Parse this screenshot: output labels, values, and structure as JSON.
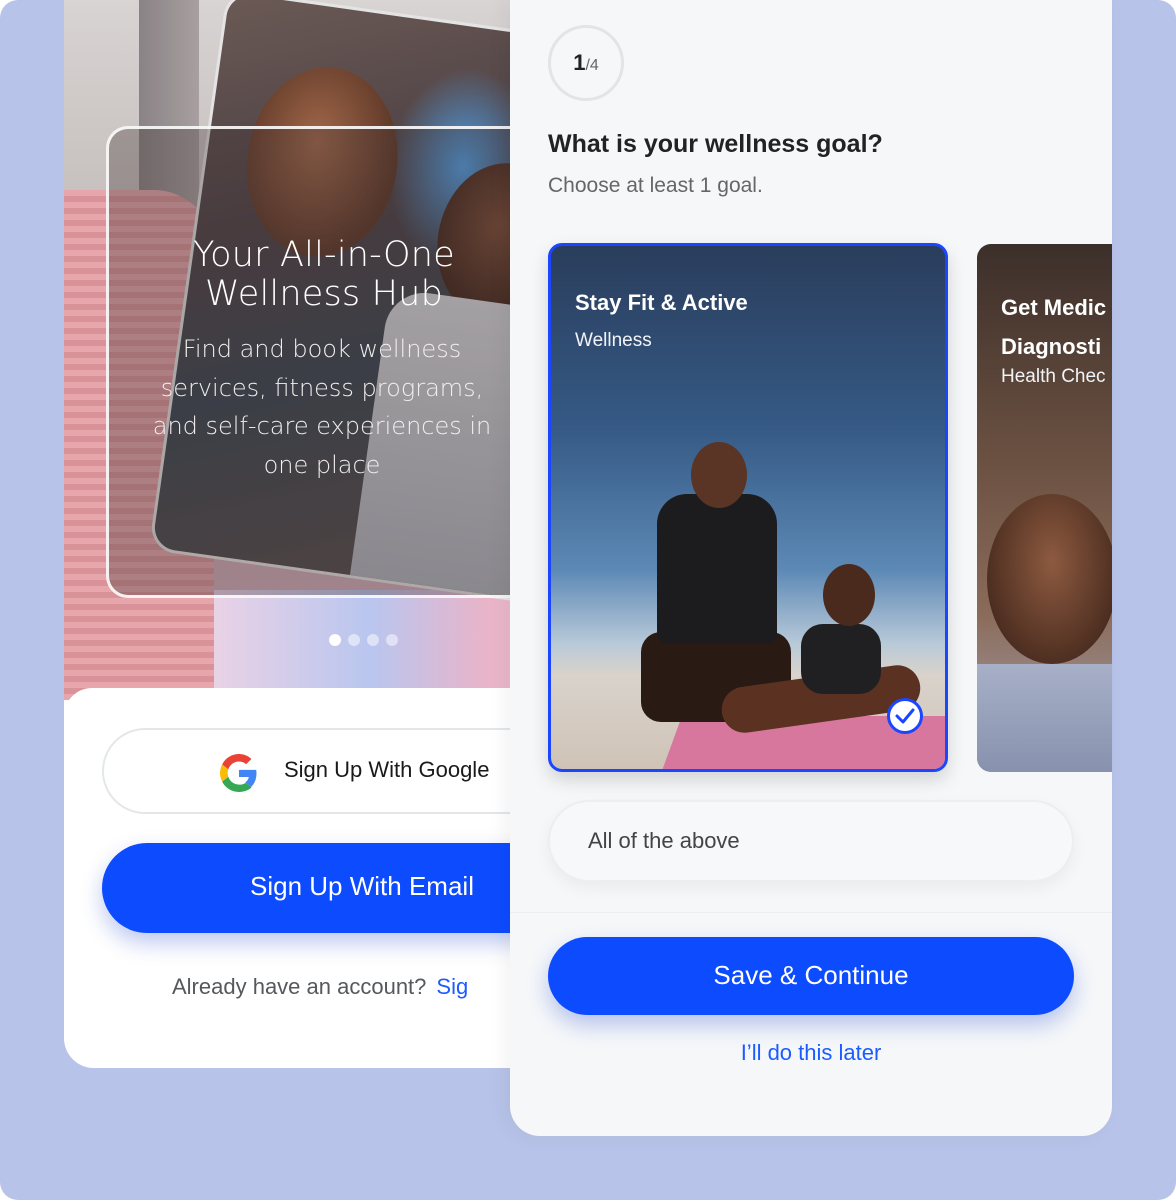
{
  "onboarding": {
    "hero_title": "Your All-in-One Wellness Hub",
    "hero_description": "Find and book wellness services, fitness programs, and self-care experiences in one place",
    "carousel": {
      "total": 4,
      "active": 1
    },
    "google_button": {
      "label": "Sign Up With Google",
      "icon": "google-g-icon"
    },
    "email_button": {
      "label": "Sign Up With Email"
    },
    "account_prompt": "Already have an account?",
    "signin_link": "Sig"
  },
  "goal_step": {
    "step_current": "1",
    "step_total": "/4",
    "question": "What is your wellness goal?",
    "hint": "Choose at least 1 goal.",
    "goals": [
      {
        "title": "Stay Fit & Active",
        "category": "Wellness",
        "selected": true
      },
      {
        "title_line1": "Get Medic",
        "title_line2": "Diagnosti",
        "category": "Health Chec",
        "selected": false
      }
    ],
    "all_option": "All of the above",
    "save_button": "Save & Continue",
    "later_link": "I’ll do this later"
  },
  "colors": {
    "accent": "#0d4bff",
    "link": "#1b5cff",
    "background": "#b7c3e8"
  }
}
